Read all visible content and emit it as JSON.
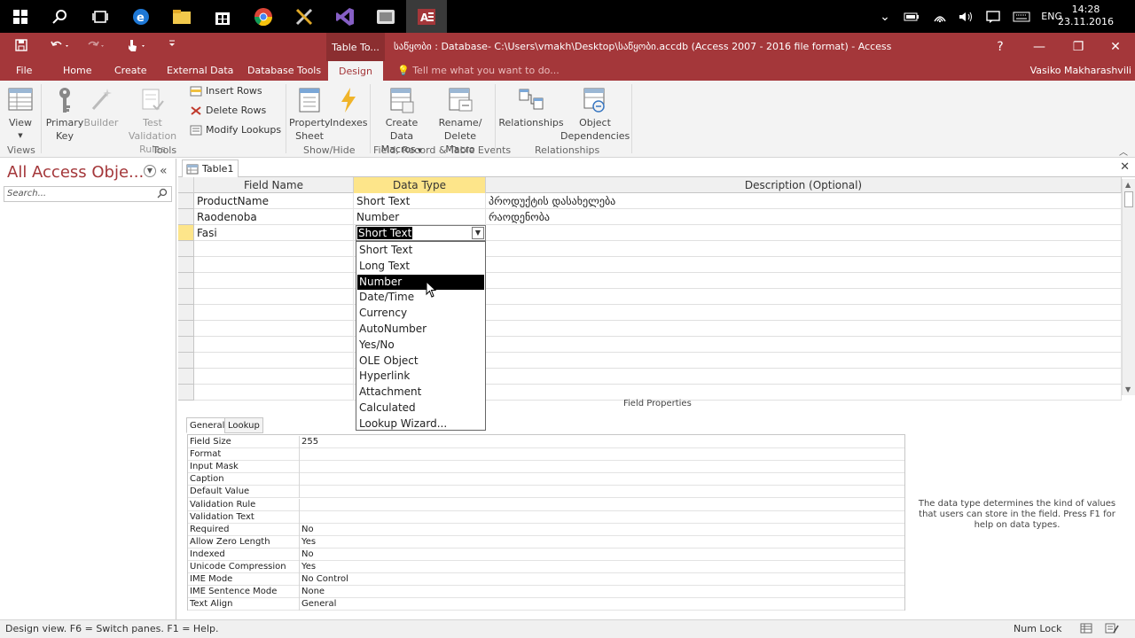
{
  "taskbar": {
    "lang": "ENG",
    "time": "14:28",
    "date": "23.11.2016",
    "apps": [
      "windows-start",
      "search",
      "task-view",
      "edge",
      "file-explorer",
      "store",
      "chrome",
      "tools",
      "visual-studio",
      "media",
      "access"
    ]
  },
  "titlebar": {
    "tool_context": "Table To...",
    "title": "საწყობი : Database- C:\\Users\\vmakh\\Desktop\\საწყობი.accdb (Access 2007 - 2016 file format) - Access",
    "help": "?",
    "minimize": "—",
    "restore": "❐",
    "close": "✕"
  },
  "ribbon_tabs": {
    "file": "File",
    "home": "Home",
    "create": "Create",
    "external": "External Data",
    "dbtools": "Database Tools",
    "design": "Design",
    "tellme": "Tell me what you want to do...",
    "user": "Vasiko Makharashvili"
  },
  "ribbon": {
    "view": "View",
    "primary_key_1": "Primary",
    "primary_key_2": "Key",
    "builder": "Builder",
    "test_validation_1": "Test Validation",
    "test_validation_2": "Rules",
    "insert_rows": "Insert Rows",
    "delete_rows": "Delete Rows",
    "modify_lookups": "Modify Lookups",
    "property_sheet_1": "Property",
    "property_sheet_2": "Sheet",
    "indexes": "Indexes",
    "create_data_macros_1": "Create Data",
    "create_data_macros_2": "Macros",
    "rename_delete_1": "Rename/",
    "rename_delete_2": "Delete Macro",
    "relationships": "Relationships",
    "object_dependencies_1": "Object",
    "object_dependencies_2": "Dependencies",
    "groups": {
      "views": "Views",
      "tools": "Tools",
      "show_hide": "Show/Hide",
      "field_events": "Field, Record & Table Events",
      "relationships": "Relationships"
    }
  },
  "nav": {
    "title": "All Access Obje...",
    "search_placeholder": "Search..."
  },
  "document": {
    "tab": "Table1",
    "columns": [
      "Field Name",
      "Data Type",
      "Description (Optional)"
    ],
    "rows": [
      {
        "field": "ProductName",
        "type": "Short Text",
        "desc": "პროდუქტის დასახელება"
      },
      {
        "field": "Raodenoba",
        "type": "Number",
        "desc": "რაოდენობა"
      },
      {
        "field": "Fasi",
        "type": "Short Text",
        "desc": ""
      }
    ],
    "dropdown": {
      "current": "Short Text",
      "options": [
        "Short Text",
        "Long Text",
        "Number",
        "Date/Time",
        "Currency",
        "AutoNumber",
        "Yes/No",
        "OLE Object",
        "Hyperlink",
        "Attachment",
        "Calculated",
        "Lookup Wizard..."
      ],
      "highlighted": "Number"
    }
  },
  "field_properties": {
    "label": "Field Properties",
    "tabs": [
      "General",
      "Lookup"
    ],
    "rows": [
      {
        "name": "Field Size",
        "value": "255"
      },
      {
        "name": "Format",
        "value": ""
      },
      {
        "name": "Input Mask",
        "value": ""
      },
      {
        "name": "Caption",
        "value": ""
      },
      {
        "name": "Default Value",
        "value": ""
      },
      {
        "name": "Validation Rule",
        "value": ""
      },
      {
        "name": "Validation Text",
        "value": ""
      },
      {
        "name": "Required",
        "value": "No"
      },
      {
        "name": "Allow Zero Length",
        "value": "Yes"
      },
      {
        "name": "Indexed",
        "value": "No"
      },
      {
        "name": "Unicode Compression",
        "value": "Yes"
      },
      {
        "name": "IME Mode",
        "value": "No Control"
      },
      {
        "name": "IME Sentence Mode",
        "value": "None"
      },
      {
        "name": "Text Align",
        "value": "General"
      }
    ],
    "help": "The data type determines the kind of values that users can store in the field. Press F1 for help on data types."
  },
  "status": {
    "text": "Design view.  F6 = Switch panes.  F1 = Help.",
    "numlock": "Num Lock"
  },
  "colors": {
    "accent": "#a4373a",
    "highlight": "#fde58a"
  }
}
